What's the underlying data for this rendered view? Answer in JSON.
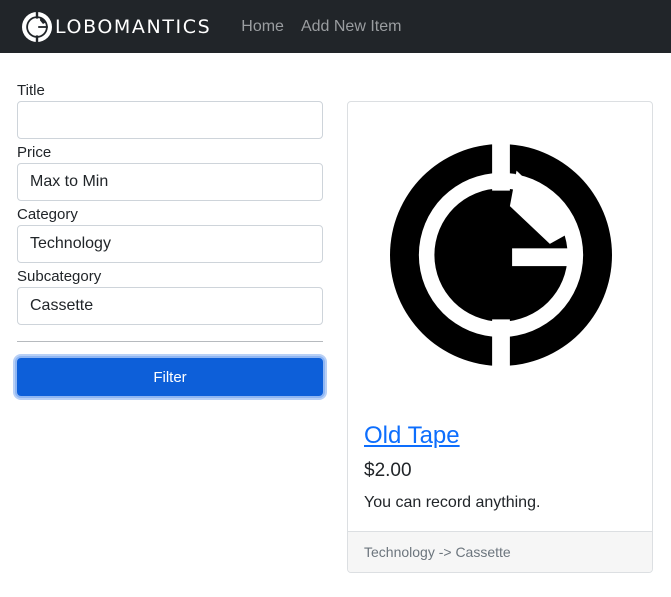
{
  "navbar": {
    "brand": "LOBOMANTICS",
    "links": [
      "Home",
      "Add New Item"
    ]
  },
  "filter": {
    "title_label": "Title",
    "title_value": "",
    "price_label": "Price",
    "price_value": "Max to Min",
    "category_label": "Category",
    "category_value": "Technology",
    "subcategory_label": "Subcategory",
    "subcategory_value": "Cassette",
    "button_label": "Filter"
  },
  "item": {
    "image": "globomantics-logo",
    "title": "Old Tape",
    "price": "$2.00",
    "description": "You can record anything.",
    "category_path": "Technology -> Cassette"
  },
  "colors": {
    "navbar_bg": "#212529",
    "primary": "#0d5fd9",
    "link": "#0d6efd"
  }
}
